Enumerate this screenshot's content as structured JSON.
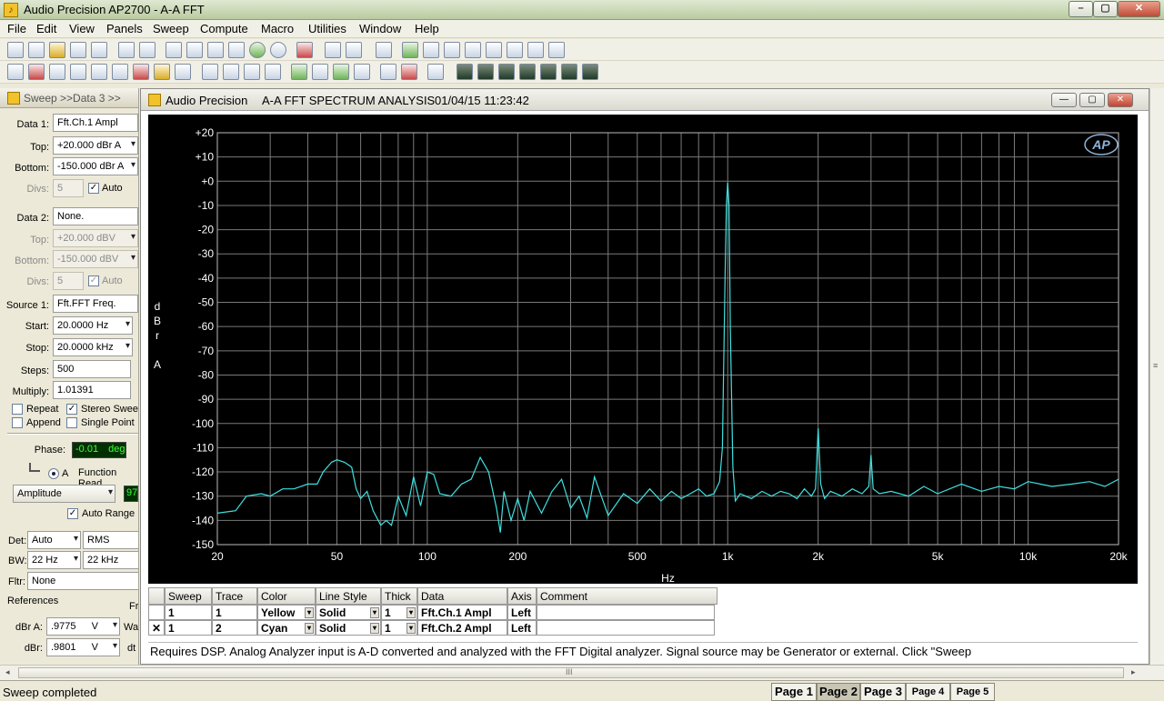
{
  "window": {
    "title": "Audio Precision AP2700 - A-A FFT"
  },
  "menu": [
    "File",
    "Edit",
    "View",
    "Panels",
    "Sweep",
    "Compute",
    "Macro",
    "Utilities",
    "Window",
    "Help"
  ],
  "panel": {
    "title": "Sweep >>Data 3 >>",
    "data1": {
      "label": "Data 1:",
      "value": "Fft.Ch.1 Ampl"
    },
    "top1": {
      "label": "Top:",
      "value": "+20.000  dBr A"
    },
    "bottom1": {
      "label": "Bottom:",
      "value": "-150.000  dBr A"
    },
    "divs1": {
      "label": "Divs:",
      "value": "5",
      "auto": "Auto"
    },
    "data2": {
      "label": "Data 2:",
      "value": "None."
    },
    "top2": {
      "label": "Top:",
      "value": "+20.000  dBV"
    },
    "bottom2": {
      "label": "Bottom:",
      "value": "-150.000  dBV"
    },
    "divs2": {
      "label": "Divs:",
      "value": "5",
      "auto": "Auto"
    },
    "source1": {
      "label": "Source 1:",
      "value": "Fft.FFT Freq."
    },
    "start": {
      "label": "Start:",
      "value": "20.0000  Hz"
    },
    "stop": {
      "label": "Stop:",
      "value": "20.0000 kHz"
    },
    "steps": {
      "label": "Steps:",
      "value": "500"
    },
    "multiply": {
      "label": "Multiply:",
      "value": "1.01391"
    },
    "repeat": "Repeat",
    "stereo_sweep": "Stereo Swee",
    "append": "Append",
    "single_point": "Single Point",
    "phase": {
      "label": "Phase:",
      "value": "-0.01",
      "unit": "deg"
    },
    "channel_a": "A",
    "function_reading": "Function Read",
    "amplitude": "Amplitude",
    "amp_reading": "97",
    "auto_range": "Auto Range",
    "det": {
      "label": "Det:",
      "value": "Auto",
      "mode": "RMS"
    },
    "bw": {
      "label": "BW:",
      "value": "22 Hz",
      "high": "22 kHz"
    },
    "fltr": {
      "label": "Fltr:",
      "value": "None"
    },
    "references": "References",
    "references_right": "Fr",
    "dbra": {
      "label": "dBr A:",
      "value": ".9775",
      "unit": "V",
      "right": "Wa"
    },
    "dbr": {
      "label": "dBr:",
      "value": ".9801",
      "unit": "V",
      "right": "dt"
    }
  },
  "graph_window": {
    "label": "Audio Precision",
    "title": "A-A FFT SPECTRUM ANALYSIS",
    "timestamp": "01/04/15 11:23:42",
    "logo": "AP"
  },
  "chart_data": {
    "type": "line",
    "xlabel": "Hz",
    "ylabel": "dBr A",
    "xscale": "log",
    "xlim": [
      20,
      20000
    ],
    "ylim": [
      -150,
      20
    ],
    "grid": true,
    "line_color": "#40e0e0",
    "x_ticks": [
      20,
      50,
      100,
      200,
      500,
      1000,
      2000,
      5000,
      10000,
      20000
    ],
    "x_tick_labels": [
      "20",
      "50",
      "100",
      "200",
      "500",
      "1k",
      "2k",
      "5k",
      "10k",
      "20k"
    ],
    "y_ticks": [
      20,
      10,
      0,
      -10,
      -20,
      -30,
      -40,
      -50,
      -60,
      -70,
      -80,
      -90,
      -100,
      -110,
      -120,
      -130,
      -140,
      -150
    ],
    "y_tick_labels": [
      "+20",
      "+10",
      "+0",
      "-10",
      "-20",
      "-30",
      "-40",
      "-50",
      "-60",
      "-70",
      "-80",
      "-90",
      "-100",
      "-110",
      "-120",
      "-130",
      "-140",
      "-150"
    ],
    "series": [
      {
        "x": [
          20,
          23,
          25,
          28,
          30,
          33,
          36,
          40,
          43,
          45,
          48,
          50,
          53,
          56,
          58,
          60,
          63,
          66,
          70,
          73,
          76,
          80,
          85,
          90,
          95,
          100,
          105,
          110,
          120,
          130,
          140,
          150,
          160,
          170,
          175,
          180,
          190,
          200,
          210,
          220,
          240,
          260,
          280,
          300,
          320,
          340,
          360,
          400,
          450,
          500,
          550,
          600,
          650,
          700,
          750,
          800,
          850,
          900,
          940,
          960,
          980,
          990,
          1000,
          1010,
          1020,
          1040,
          1060,
          1100,
          1200,
          1300,
          1400,
          1500,
          1600,
          1700,
          1800,
          1900,
          1960,
          2000,
          2040,
          2100,
          2200,
          2400,
          2600,
          2800,
          2950,
          3000,
          3050,
          3200,
          3500,
          4000,
          4500,
          5000,
          6000,
          7000,
          8000,
          9000,
          10000,
          12000,
          14000,
          16000,
          18000,
          20000
        ],
        "y": [
          -137,
          -136,
          -130,
          -129,
          -130,
          -127,
          -127,
          -125,
          -125,
          -120,
          -116,
          -115,
          -116,
          -118,
          -127,
          -131,
          -128,
          -136,
          -142,
          -140,
          -142,
          -130,
          -138,
          -122,
          -134,
          -120,
          -121,
          -129,
          -130,
          -125,
          -123,
          -114,
          -120,
          -135,
          -145,
          -128,
          -140,
          -131,
          -140,
          -128,
          -137,
          -128,
          -123,
          -135,
          -130,
          -139,
          -122,
          -138,
          -129,
          -133,
          -127,
          -132,
          -128,
          -131,
          -129,
          -127,
          -130,
          -129,
          -124,
          -110,
          -40,
          -10,
          -0.5,
          -10,
          -60,
          -118,
          -132,
          -129,
          -131,
          -128,
          -130,
          -128,
          -129,
          -131,
          -127,
          -130,
          -127,
          -102,
          -125,
          -131,
          -128,
          -130,
          -127,
          -129,
          -126,
          -113,
          -127,
          -129,
          -128,
          -130,
          -126,
          -129,
          -125,
          -128,
          -126,
          -127,
          -124,
          -126,
          -125,
          -124,
          -126,
          -123
        ]
      }
    ]
  },
  "trace_table": {
    "headers": [
      "Sweep",
      "Trace",
      "Color",
      "Line Style",
      "Thick",
      "Data",
      "Axis",
      "Comment"
    ],
    "rows": [
      {
        "sweep": "1",
        "trace": "1",
        "color": "Yellow",
        "style": "Solid",
        "thick": "1",
        "data": "Fft.Ch.1 Ampl",
        "axis": "Left",
        "checked": ""
      },
      {
        "sweep": "1",
        "trace": "2",
        "color": "Cyan",
        "style": "Solid",
        "thick": "1",
        "data": "Fft.Ch.2 Ampl",
        "axis": "Left",
        "checked": "✕"
      }
    ]
  },
  "comment": "Requires DSP.  Analog Analyzer input is A-D converted and analyzed with the FFT Digital analyzer.  Signal source may be Generator or external.  Click \"Sweep",
  "status": "Sweep completed",
  "hscroll_grip": "III",
  "pages": [
    "Page 1",
    "Page 2",
    "Page 3",
    "Page 4",
    "Page 5"
  ]
}
